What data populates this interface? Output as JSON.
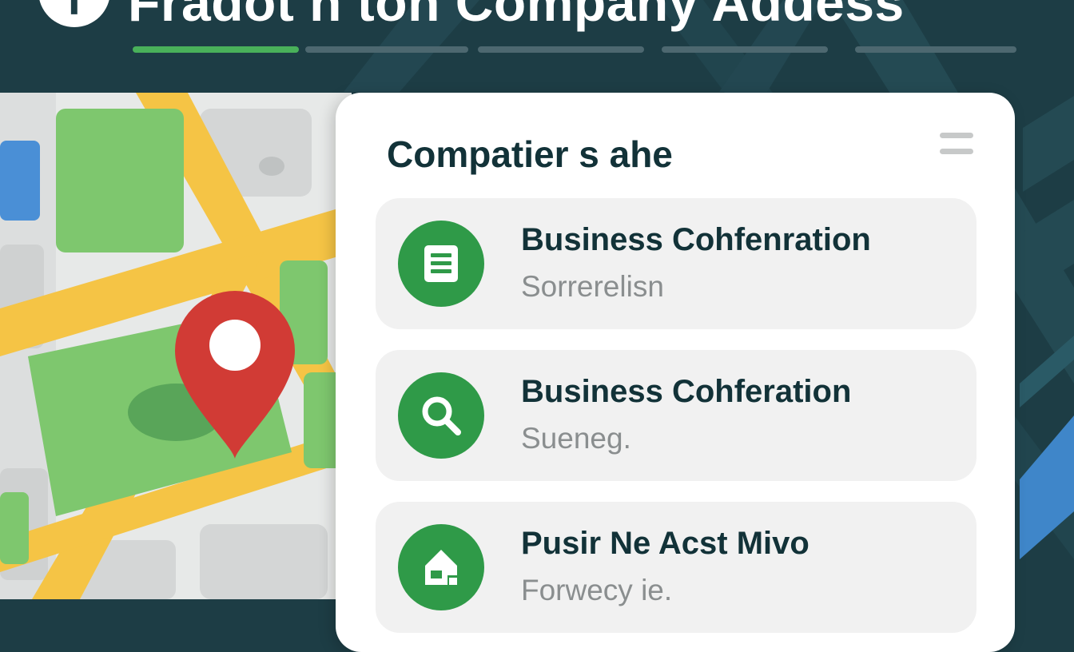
{
  "header": {
    "title": "Fradot n ton Company  Addess",
    "logo_glyph": "f",
    "progress": {
      "step_count": 5,
      "active_step": 1
    }
  },
  "map": {
    "pin_color": "#d13b35"
  },
  "panel": {
    "title": "Compatier s ahe",
    "menu_icon": "menu-icon",
    "items": [
      {
        "title": "Business Cohfenration",
        "subtitle": "Sorrerelisn",
        "icon": "document-icon"
      },
      {
        "title": "Business Cohferation",
        "subtitle": "Sueneg.",
        "icon": "search-icon"
      },
      {
        "title": "Pusir Ne Acst Mivo",
        "subtitle": "Forwecy ie.",
        "icon": "tag-icon"
      }
    ]
  },
  "colors": {
    "background": "#1d3d45",
    "accent_green": "#2f9a48",
    "progress_active": "#49b15a",
    "map_road": "#f5c445",
    "map_park": "#7ec76e"
  }
}
